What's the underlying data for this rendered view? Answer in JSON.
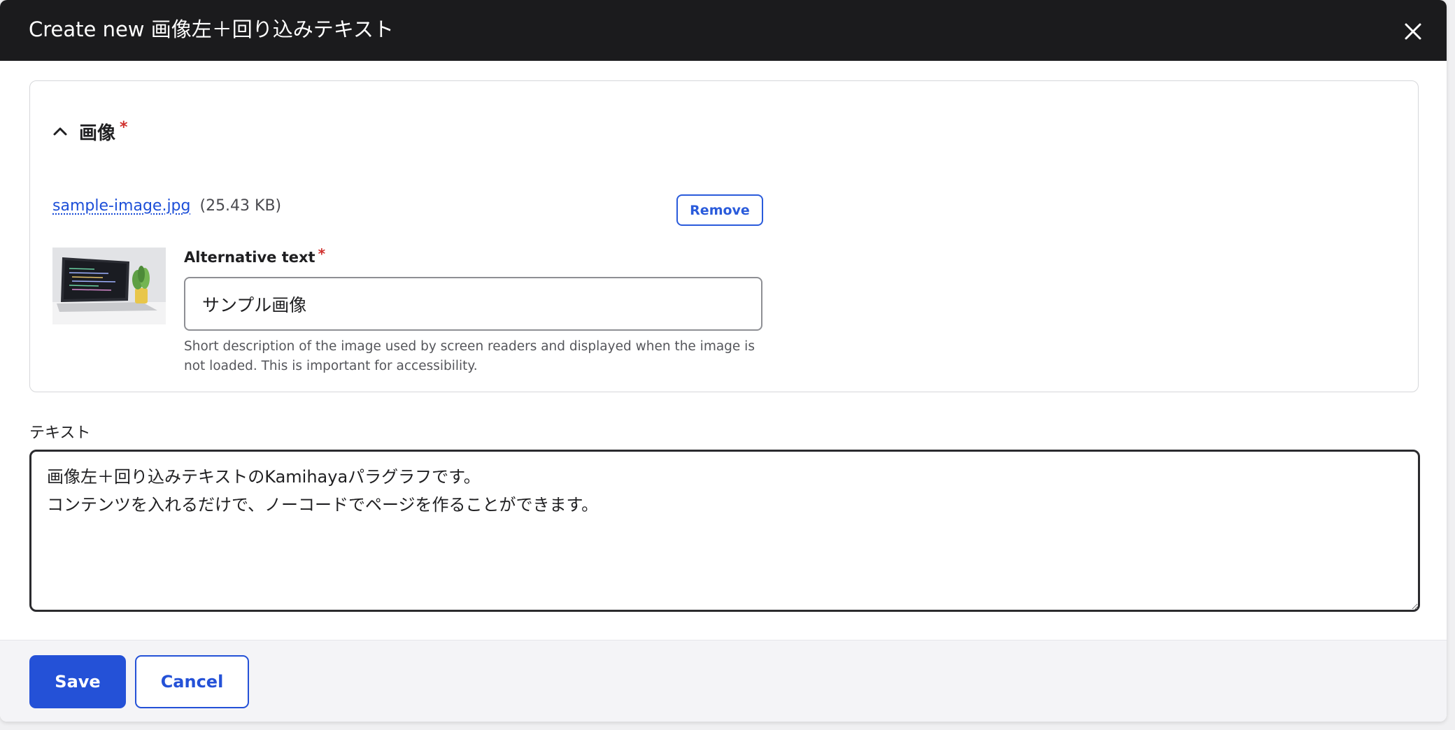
{
  "dialog": {
    "title": "Create new 画像左＋回り込みテキスト",
    "close_icon": "close-icon"
  },
  "image_section": {
    "title": "画像",
    "required_mark": "*",
    "collapse_icon": "chevron-up-icon",
    "file": {
      "name": "sample-image.jpg",
      "size": "(25.43 KB)"
    },
    "remove_label": "Remove",
    "thumbnail": "laptop-photo",
    "alt_text": {
      "label": "Alternative text",
      "required_mark": "*",
      "value": "サンプル画像",
      "help": "Short description of the image used by screen readers and displayed when the image is not loaded. This is important for accessibility."
    }
  },
  "text_field": {
    "label": "テキスト",
    "value": "画像左＋回り込みテキストのKamihayaパラグラフです。\nコンテンツを入れるだけで、ノーコードでページを作ることができます。"
  },
  "footer": {
    "save_label": "Save",
    "cancel_label": "Cancel"
  },
  "colors": {
    "titlebar": "#1b1b1d",
    "primary": "#2451d7",
    "required": "#d0302d"
  }
}
